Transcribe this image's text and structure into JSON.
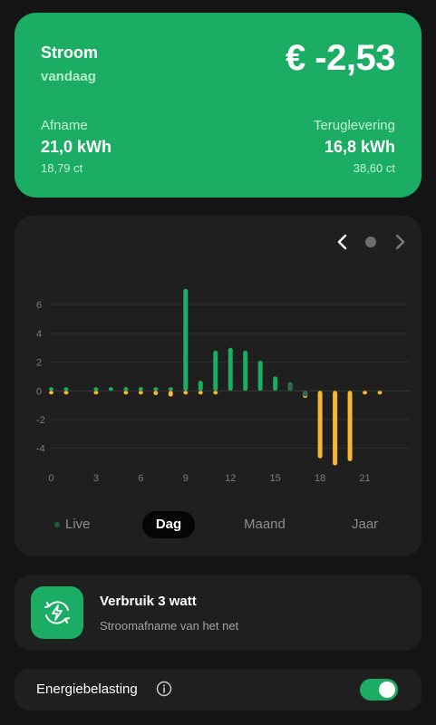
{
  "summary": {
    "title": "Stroom",
    "subtitle": "vandaag",
    "amount": "€ -2,53",
    "afname": {
      "label": "Afname",
      "value": "21,0 kWh",
      "price": "18,79 ct"
    },
    "teruglevering": {
      "label": "Teruglevering",
      "value": "16,8 kWh",
      "price": "38,60 ct"
    }
  },
  "chart_nav": {
    "prev_icon": "chevron-left-icon",
    "next_icon": "chevron-right-icon"
  },
  "chart_data": {
    "type": "bar",
    "x_ticks": [
      "0",
      "3",
      "6",
      "9",
      "12",
      "15",
      "18",
      "21"
    ],
    "x_tick_values": [
      0,
      3,
      6,
      9,
      12,
      15,
      18,
      21
    ],
    "y_ticks": [
      "6",
      "4",
      "2",
      "0",
      "-2",
      "-4"
    ],
    "y_tick_values": [
      6,
      4,
      2,
      0,
      -2,
      -4
    ],
    "ylim": [
      -5.6,
      7.4
    ],
    "xlim": [
      -1,
      24
    ],
    "grid": true,
    "series": [
      {
        "color": "#1bad63",
        "hours": [
          0,
          1,
          3,
          4,
          5,
          6,
          7,
          8,
          9,
          10,
          11,
          12,
          13,
          14,
          15,
          16
        ],
        "values": [
          0.02,
          0.02,
          0.02,
          0.1,
          0.02,
          0.02,
          0.02,
          0.15,
          7.1,
          0.7,
          2.8,
          3.0,
          2.8,
          2.1,
          1.0,
          0.6
        ]
      },
      {
        "color": "#f5b82e",
        "hours": [
          0,
          1,
          3,
          5,
          6,
          7,
          8,
          9,
          10,
          11,
          17,
          18,
          19,
          20,
          21,
          22
        ],
        "values": [
          -0.1,
          -0.1,
          -0.1,
          -0.1,
          -0.1,
          -0.3,
          -0.4,
          -0.1,
          -0.1,
          -0.1,
          -0.5,
          -4.7,
          -5.2,
          -4.9,
          -0.1,
          -0.1
        ]
      },
      {
        "color": "#2f6b4a",
        "hours": [
          16,
          17
        ],
        "values": [
          0.55,
          -0.4
        ]
      }
    ]
  },
  "tabs": {
    "live": "Live",
    "dag": "Dag",
    "maand": "Maand",
    "jaar": "Jaar"
  },
  "usage": {
    "title": "Verbruik 3 watt",
    "subtitle": "Stroomafname van het net",
    "icon": "bolt-icon"
  },
  "tax": {
    "label": "Energiebelasting",
    "info_icon": "info-icon",
    "toggle_on": true
  },
  "colors": {
    "accent": "#1bad63",
    "negative": "#f5b82e",
    "card": "#1f1f1f",
    "background": "#141414"
  }
}
